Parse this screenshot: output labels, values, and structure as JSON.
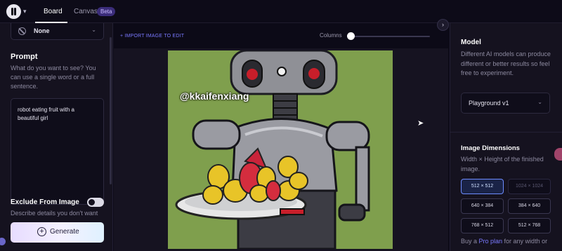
{
  "topbar": {
    "tabs": [
      {
        "label": "Board",
        "active": true
      },
      {
        "label": "Canvas",
        "active": false,
        "badge": "Beta"
      }
    ]
  },
  "left_panel": {
    "negative_select_value": "None",
    "prompt_heading": "Prompt",
    "prompt_help": "What do you want to see? You can use a single word or a full sentence.",
    "prompt_value": "robot eating fruit with a beautiful girl",
    "exclude_heading": "Exclude From Image",
    "exclude_help": "Describe details you don't want",
    "generate_label": "Generate"
  },
  "center": {
    "import_label": "+ IMPORT IMAGE TO EDIT",
    "columns_label": "Columns",
    "columns_level": 0.0,
    "watermark": "@kkaifenxiang"
  },
  "right_panel": {
    "model_heading": "Model",
    "model_help": "Different AI models can produce different or better results so feel free to experiment.",
    "model_value": "Playground v1",
    "dims_heading": "Image Dimensions",
    "dims_help": "Width × Height of the finished image.",
    "dimensions": [
      {
        "label": "512 × 512",
        "state": "active"
      },
      {
        "label": "1024 × 1024",
        "state": "disabled"
      },
      {
        "label": "640 × 384",
        "state": "normal"
      },
      {
        "label": "384 × 640",
        "state": "normal"
      },
      {
        "label": "768 × 512",
        "state": "normal"
      },
      {
        "label": "512 × 768",
        "state": "normal"
      }
    ],
    "pro_prefix": "Buy a ",
    "pro_link": "Pro plan",
    "pro_suffix": " for any width or"
  },
  "colors": {
    "accent": "#7a79ff",
    "background": "#0c0a17",
    "panel": "#15121f",
    "art_background": "#7c9c4a"
  },
  "icons": [
    "logo-icon",
    "chevron-down-icon",
    "ban-icon",
    "plus-circle-icon",
    "chevron-right-icon",
    "cursor-icon"
  ]
}
